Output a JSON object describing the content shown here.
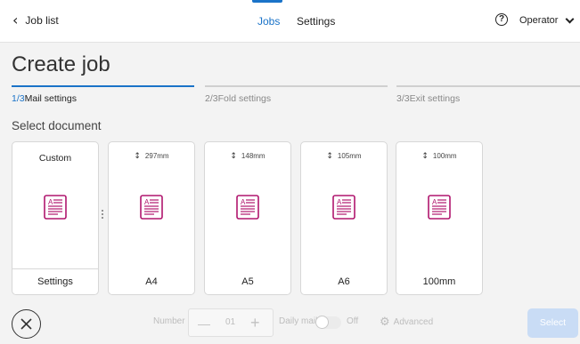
{
  "header": {
    "back_label": "Job list",
    "tabs": [
      {
        "label": "Jobs",
        "active": true
      },
      {
        "label": "Settings",
        "active": false
      }
    ],
    "help_icon": "question-circle-icon",
    "user_label": "Operator"
  },
  "page": {
    "title": "Create job",
    "section_label": "Select document"
  },
  "steps": [
    {
      "num": "1/3",
      "label": "Mail settings",
      "active": true
    },
    {
      "num": "2/3",
      "label": "Fold settings",
      "active": false
    },
    {
      "num": "3/3",
      "label": "Exit settings",
      "active": false
    }
  ],
  "documents": [
    {
      "top": "Custom",
      "name": "Settings"
    },
    {
      "dimension": "297mm",
      "name": "A4"
    },
    {
      "dimension": "148mm",
      "name": "A5"
    },
    {
      "dimension": "105mm",
      "name": "A6"
    },
    {
      "dimension": "100mm",
      "name": "100mm"
    }
  ],
  "footer": {
    "number_label": "Number",
    "number_value": "01",
    "minus_symbol": "—",
    "plus_symbol": "+",
    "daily_mail_label": "Daily mail",
    "daily_mail_state": "Off",
    "advanced_label": "Advanced",
    "select_label": "Select"
  },
  "colors": {
    "accent": "#1a73c8",
    "doc_icon": "#b0166e",
    "select_disabled": "#c9dcf5"
  }
}
